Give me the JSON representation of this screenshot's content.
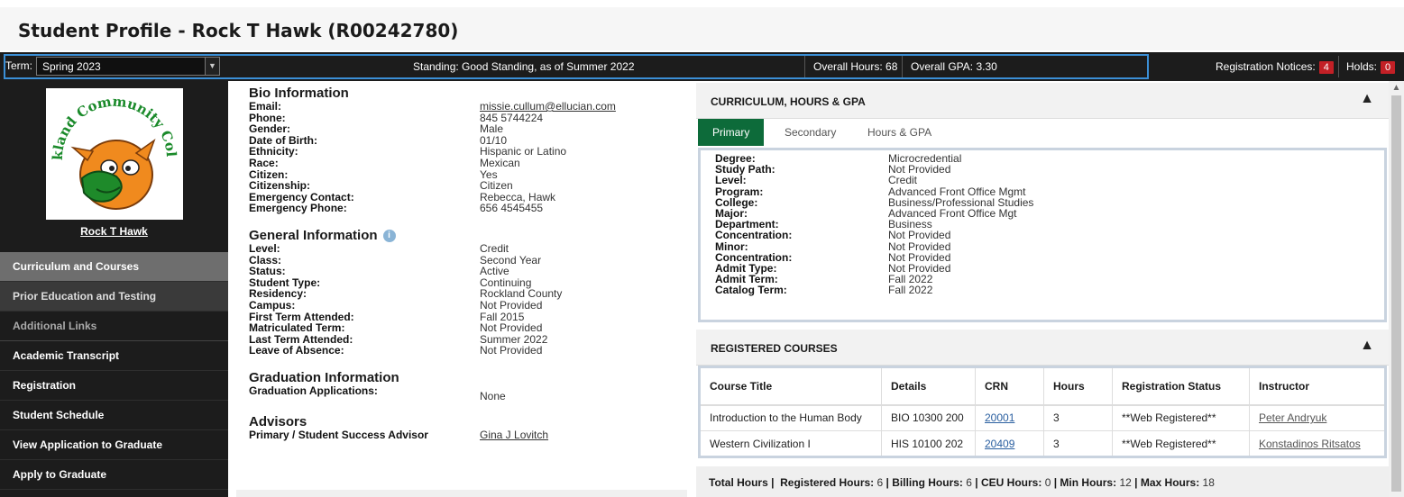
{
  "page": {
    "title": "Student Profile - Rock T Hawk (R00242780)"
  },
  "status_bar": {
    "term_label": "Term:",
    "term_value": "Spring 2023",
    "standing": "Standing: Good Standing, as of Summer 2022",
    "overall_hours": "Overall Hours: 68",
    "overall_gpa": "Overall GPA: 3.30",
    "reg_notices_label": "Registration Notices:",
    "reg_notices_count": "4",
    "holds_label": "Holds:",
    "holds_count": "0",
    "accent_color": "#3b8fd6",
    "badge_color": "#c32026"
  },
  "sidebar": {
    "logo_text": "Rockland Community College",
    "student_name": "Rock T Hawk",
    "items": [
      {
        "label": "Curriculum and Courses"
      },
      {
        "label": "Prior Education and Testing"
      },
      {
        "label": "Additional Links"
      },
      {
        "label": "Academic Transcript"
      },
      {
        "label": "Registration"
      },
      {
        "label": "Student Schedule"
      },
      {
        "label": "View Application to Graduate"
      },
      {
        "label": "Apply to Graduate"
      }
    ]
  },
  "bio": {
    "title": "Bio Information",
    "rows": [
      {
        "k": "Email:",
        "v": "missie.cullum@ellucian.com"
      },
      {
        "k": "Phone:",
        "v": "845 5744224"
      },
      {
        "k": "Gender:",
        "v": "Male"
      },
      {
        "k": "Date of Birth:",
        "v": "01/10"
      },
      {
        "k": "Ethnicity:",
        "v": "Hispanic or Latino"
      },
      {
        "k": "Race:",
        "v": "Mexican"
      },
      {
        "k": "Citizen:",
        "v": "Yes"
      },
      {
        "k": "Citizenship:",
        "v": "Citizen"
      },
      {
        "k": "Emergency Contact:",
        "v": "Rebecca, Hawk"
      },
      {
        "k": "Emergency Phone:",
        "v": "656 4545455"
      }
    ]
  },
  "general": {
    "title": "General Information",
    "rows": [
      {
        "k": "Level:",
        "v": "Credit"
      },
      {
        "k": "Class:",
        "v": "Second Year"
      },
      {
        "k": "Status:",
        "v": "Active"
      },
      {
        "k": "Student Type:",
        "v": "Continuing"
      },
      {
        "k": "Residency:",
        "v": "Rockland County"
      },
      {
        "k": "Campus:",
        "v": "Not Provided"
      },
      {
        "k": "First Term Attended:",
        "v": "Fall 2015"
      },
      {
        "k": "Matriculated Term:",
        "v": "Not Provided"
      },
      {
        "k": "Last Term Attended:",
        "v": "Summer 2022"
      },
      {
        "k": "Leave of Absence:",
        "v": "Not Provided"
      }
    ]
  },
  "graduation": {
    "title": "Graduation Information",
    "label": "Graduation Applications:",
    "value": "None"
  },
  "advisors": {
    "title": "Advisors",
    "label": "Primary / Student Success Advisor",
    "value": "Gina J Lovitch"
  },
  "curriculum": {
    "title": "CURRICULUM, HOURS & GPA",
    "tabs": [
      "Primary",
      "Secondary",
      "Hours & GPA"
    ],
    "active_color": "#0d6b3a",
    "rows": [
      {
        "k": "Degree:",
        "v": "Microcredential"
      },
      {
        "k": "Study Path:",
        "v": "Not Provided"
      },
      {
        "k": "Level:",
        "v": "Credit"
      },
      {
        "k": "Program:",
        "v": "Advanced Front Office Mgmt"
      },
      {
        "k": "College:",
        "v": "Business/Professional Studies"
      },
      {
        "k": "Major:",
        "v": "Advanced Front Office Mgt"
      },
      {
        "k": "Department:",
        "v": "Business"
      },
      {
        "k": "Concentration:",
        "v": "Not Provided"
      },
      {
        "k": "Minor:",
        "v": "Not Provided"
      },
      {
        "k": "Concentration:",
        "v": "Not Provided"
      },
      {
        "k": "Admit Type:",
        "v": "Not Provided"
      },
      {
        "k": "Admit Term:",
        "v": "Fall 2022"
      },
      {
        "k": "Catalog Term:",
        "v": "Fall 2022"
      }
    ]
  },
  "registered": {
    "title": "REGISTERED COURSES",
    "columns": [
      "Course Title",
      "Details",
      "CRN",
      "Hours",
      "Registration Status",
      "Instructor"
    ],
    "rows": [
      [
        "Introduction to the Human Body",
        "BIO 10300 200",
        "20001",
        "3",
        "**Web Registered**",
        "Peter Andryuk"
      ],
      [
        "Western Civilization I",
        "HIS 10100 202",
        "20409",
        "3",
        "**Web Registered**",
        "Konstadinos Ritsatos"
      ]
    ],
    "totals": {
      "total_hours": "Total Hours |",
      "registered_label": "Registered Hours:",
      "registered": "6",
      "billing_label": "Billing Hours:",
      "billing": "6",
      "ceu_label": "CEU Hours:",
      "ceu": "0",
      "min_label": "Min Hours:",
      "min": "12",
      "max_label": "Max Hours:",
      "max": "18"
    }
  }
}
